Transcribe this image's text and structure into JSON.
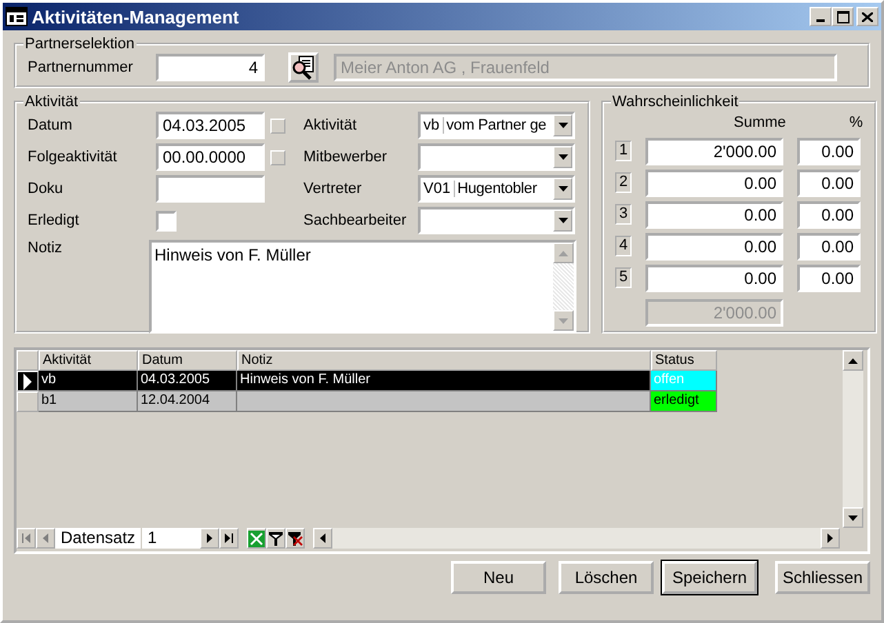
{
  "window": {
    "title": "Aktivitäten-Management"
  },
  "partner": {
    "legend": "Partnerselektion",
    "label": "Partnernummer",
    "number": "4",
    "name": "Meier Anton AG , Frauenfeld"
  },
  "activity": {
    "legend": "Aktivität",
    "left": [
      {
        "kind": "date",
        "label": "Datum",
        "value": "04.03.2005"
      },
      {
        "kind": "date",
        "label": "Folgeaktivität",
        "value": "00.00.0000"
      },
      {
        "kind": "text",
        "label": "Doku"
      },
      {
        "kind": "checkbox",
        "label": "Erledigt",
        "checked": false
      }
    ],
    "right": [
      {
        "label": "Aktivität",
        "code": "vb",
        "value": "vom Partner ge"
      },
      {
        "label": "Mitbewerber"
      },
      {
        "label": "Vertreter",
        "code": "V01",
        "value": "Hugentobler"
      },
      {
        "label": "Sachbearbeiter"
      }
    ],
    "note_label": "Notiz",
    "note": "Hinweis von F. Müller"
  },
  "probability": {
    "legend": "Wahrscheinlichkeit",
    "sum_header": "Summe",
    "pct_header": "%",
    "rows": [
      {
        "number": "1",
        "sum": "2'000.00",
        "pct": "0.00"
      },
      {
        "number": "2",
        "sum": "0.00",
        "pct": "0.00"
      },
      {
        "number": "3",
        "sum": "0.00",
        "pct": "0.00"
      },
      {
        "number": "4",
        "sum": "0.00",
        "pct": "0.00"
      },
      {
        "number": "5",
        "sum": "0.00",
        "pct": "0.00"
      }
    ],
    "total": "2'000.00"
  },
  "grid": {
    "columns": [
      "Aktivität",
      "Datum",
      "Notiz",
      "Status"
    ],
    "rows": [
      {
        "selected": true,
        "cells": [
          "vb",
          "04.03.2005",
          "Hinweis von F. Müller"
        ],
        "status": "offen",
        "color": "#00ffff"
      },
      {
        "selected": false,
        "cells": [
          "b1",
          "12.04.2004",
          ""
        ],
        "status": "erledigt",
        "color": "#00ff00"
      }
    ],
    "nav_label": "Datensatz",
    "record": "1"
  },
  "buttons": [
    {
      "label": "Neu",
      "default": false
    },
    {
      "label": "Löschen",
      "default": false
    },
    {
      "label": "Speichern",
      "default": true
    },
    {
      "label": "Schliessen",
      "default": false
    }
  ]
}
